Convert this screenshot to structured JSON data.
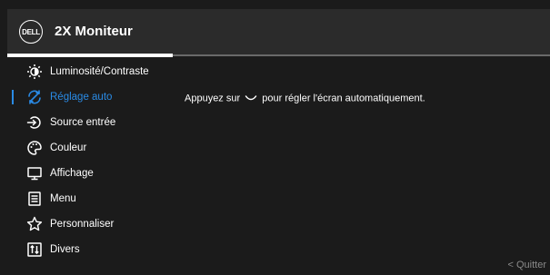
{
  "header": {
    "logo_text": "DELL",
    "title": "2X Moniteur"
  },
  "menu": {
    "items": [
      {
        "label": "Luminosité/Contraste",
        "icon": "brightness-icon"
      },
      {
        "label": "Réglage auto",
        "icon": "auto-adjust-icon",
        "selected": true
      },
      {
        "label": "Source entrée",
        "icon": "input-source-icon"
      },
      {
        "label": "Couleur",
        "icon": "color-palette-icon"
      },
      {
        "label": "Affichage",
        "icon": "display-icon"
      },
      {
        "label": "Menu",
        "icon": "menu-icon"
      },
      {
        "label": "Personnaliser",
        "icon": "star-icon"
      },
      {
        "label": "Divers",
        "icon": "others-icon"
      }
    ]
  },
  "content": {
    "message_before": "Appuyez sur",
    "message_after": "pour régler l'écran automatiquement.",
    "confirm_icon": "checkmark-icon"
  },
  "footer": {
    "back_glyph": "<",
    "quit_label": "Quitter"
  },
  "colors": {
    "background": "#1b1b1b",
    "header": "#2b2b2b",
    "accent": "#2a8be6",
    "text": "#ffffff",
    "muted": "#8a8a8a"
  }
}
